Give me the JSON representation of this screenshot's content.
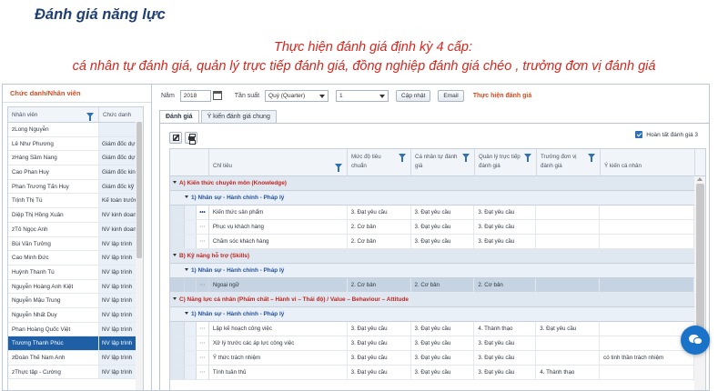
{
  "page_title": "Đánh giá năng lực",
  "banner": {
    "line1": "Thực hiện đánh giá định kỳ 4 cấp:",
    "line2": "cá nhân tự đánh giá, quản lý trực tiếp đánh giá, đồng nghiệp đánh giá chéo , trưởng đơn vị đánh giá"
  },
  "employee_panel": {
    "title": "Chức danh/Nhân viên",
    "columns": [
      "Nhân viên",
      "Chức danh"
    ],
    "rows": [
      {
        "name": "zLong Nguyễn",
        "title": ""
      },
      {
        "name": "Lê Như Phương",
        "title": "Giám đốc dự á"
      },
      {
        "name": "zHàng Sầm Nang",
        "title": "Giám đốc dự á"
      },
      {
        "name": "Cao Phan Huy",
        "title": "Giám đốc kinh"
      },
      {
        "name": "Phan Trương Tấn Huy",
        "title": "Giám đốc kỹ th"
      },
      {
        "name": "Trịnh Thị Tú",
        "title": "Kế toán trưởn"
      },
      {
        "name": "Diệp Thị Hồng Xuân",
        "title": "NV kinh doanh"
      },
      {
        "name": "zTô Ngọc Anh",
        "title": "NV kinh doanh"
      },
      {
        "name": "Bùi Văn Tưởng",
        "title": "NV lập trình"
      },
      {
        "name": "Cao Minh Đức",
        "title": "NV lập trình"
      },
      {
        "name": "Huỳnh Thanh Tú",
        "title": "NV lập trình"
      },
      {
        "name": "Nguyễn Hoàng Anh Kiệt",
        "title": "NV lập trình"
      },
      {
        "name": "Nguyễn Mậu Trung",
        "title": "NV lập trình"
      },
      {
        "name": "Nguyễn Nhất Duy",
        "title": "NV lập trình"
      },
      {
        "name": "Phan Hoàng Quốc Việt",
        "title": "NV lập trình"
      },
      {
        "name": "Trương Thanh Phúc",
        "title": "NV lập trình"
      },
      {
        "name": "zĐoàn Thế Nam Anh",
        "title": "NV lập trình"
      },
      {
        "name": "zThực tập - Cường",
        "title": "NV lập trình"
      }
    ]
  },
  "toolbar": {
    "year_label": "Năm",
    "year_value": "2018",
    "frequency_label": "Tần suất",
    "frequency_value": "Quý (Quarter)",
    "period_value": "1",
    "update_button": "Cập nhật",
    "email_button": "Email",
    "perform_link": "Thực hiện đánh giá"
  },
  "tabs": [
    "Đánh giá",
    "Ý kiến đánh giá chung"
  ],
  "complete_checkbox": {
    "label": "Hoàn tất đánh giá 3",
    "checked": true
  },
  "grid": {
    "columns": [
      "Chỉ tiêu",
      "Mức độ tiêu chuẩn",
      "Cá nhân tự đánh giá",
      "Quản lý trực tiếp đánh giá",
      "Trưởng đơn vị đánh giá",
      "Ý kiến cá nhân"
    ],
    "groups": [
      {
        "label": "A) Kiến thức chuyên môn (Knowledge)",
        "subgroups": [
          {
            "label": "1) Nhân sự - Hành chính - Pháp lý",
            "rows": [
              {
                "dots": "•••",
                "name": "Kiến thức sản phẩm",
                "std": "3. Đạt yêu cầu",
                "self": "3. Đạt yêu cầu",
                "mgr": "3. Đạt yêu cầu",
                "head": "",
                "comment": ""
              },
              {
                "dots": "···",
                "name": "Phục vụ khách hàng",
                "std": "2. Cơ bản",
                "self": "3. Đạt yêu cầu",
                "mgr": "3. Đạt yêu cầu",
                "head": "",
                "comment": ""
              },
              {
                "dots": "···",
                "name": "Chăm sóc khách hàng",
                "std": "2. Cơ bản",
                "self": "3. Đạt yêu cầu",
                "mgr": "3. Đạt yêu cầu",
                "head": "",
                "comment": ""
              }
            ]
          }
        ]
      },
      {
        "label": "B) Kỹ năng hỗ trợ (Skills)",
        "subgroups": [
          {
            "label": "1) Nhân sự - Hành chính - Pháp lý",
            "rows": [
              {
                "dots": "···",
                "name": "Ngoại ngữ",
                "std": "2. Cơ bản",
                "self": "2. Cơ bản",
                "mgr": "2. Cơ bản",
                "head": "",
                "comment": "",
                "highlight": true
              }
            ]
          }
        ]
      },
      {
        "label": "C) Năng lực cá nhân (Phẩm chất – Hành vi – Thái độ) / Value – Behaviour – Attitude",
        "subgroups": [
          {
            "label": "1) Nhân sự - Hành chính - Pháp lý",
            "rows": [
              {
                "dots": "···",
                "name": "Lập kế hoạch công việc",
                "std": "3. Đạt yêu cầu",
                "self": "3. Đạt yêu cầu",
                "mgr": "4. Thành thạo",
                "head": "3. Đạt yêu cầu",
                "comment": ""
              },
              {
                "dots": "···",
                "name": "Xử lý trước các áp lực công việc",
                "std": "3. Đạt yêu cầu",
                "self": "3. Đạt yêu cầu",
                "mgr": "3. Đạt yêu cầu",
                "head": "",
                "comment": ""
              },
              {
                "dots": "···",
                "name": "Ý thức trách nhiệm",
                "std": "3. Đạt yêu cầu",
                "self": "3. Đạt yêu cầu",
                "mgr": "3. Đạt yêu cầu",
                "head": "",
                "comment": "có tinh thần trách nhiệm"
              },
              {
                "dots": "···",
                "name": "Tính tuân thủ",
                "std": "3. Đạt yêu cầu",
                "self": "3. Đạt yêu cầu",
                "mgr": "3. Đạt yêu cầu",
                "head": "4. Thành thạo",
                "comment": ""
              }
            ]
          }
        ]
      }
    ]
  },
  "selected_employee_index": 15,
  "colors": {
    "accent": "#1f5fa5",
    "banner": "#d9251d",
    "title": "#1f3f73",
    "group": "#c0241c",
    "subgroup": "#2350a0"
  },
  "icons": [
    "calendar-icon",
    "edit-icon",
    "print-icon",
    "filter-icon",
    "chat-icon"
  ]
}
